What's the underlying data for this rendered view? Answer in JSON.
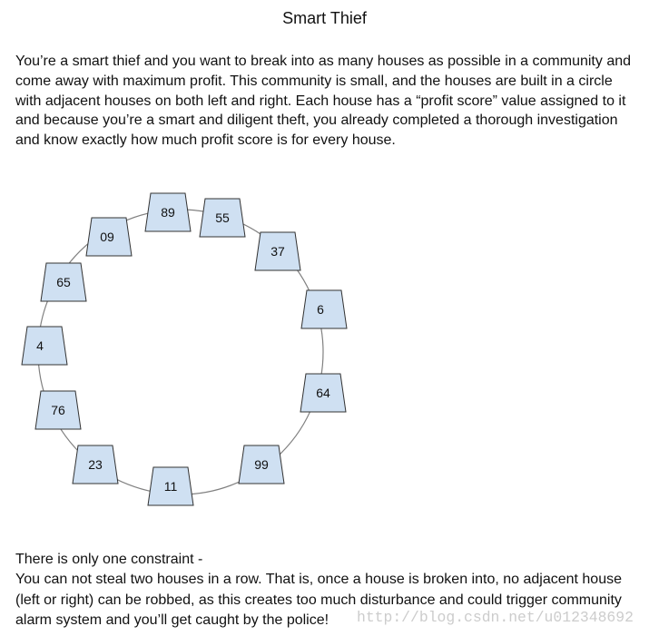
{
  "title": "Smart Thief",
  "intro_lines": [
    "You’re a smart thief and you want to break into as many houses as possible in a community and",
    "come away with maximum profit. This community is small, and the houses are built in a circle",
    "with adjacent houses on both left and right. Each house has a “profit score” value assigned to it",
    "and because you’re a smart and diligent theft, you already completed a thorough investigation",
    "and know exactly how much profit score is for every house."
  ],
  "diagram": {
    "houses": [
      "89",
      "55",
      "37",
      "6",
      "64",
      "99",
      "11",
      "23",
      "76",
      "4",
      "65",
      "09"
    ],
    "colors": {
      "house_fill": "#cfe0f2",
      "house_stroke": "#333333",
      "ring_stroke": "#808080",
      "label_color": "#111111"
    }
  },
  "constraint_lines": [
    "There is only one constraint -",
    "You can not steal two houses in a row. That is, once a house is broken into, no adjacent house",
    "(left or right) can be robbed, as this creates too much disturbance and could trigger community",
    "alarm system and you’ll get caught by the police!"
  ],
  "watermark": "http://blog.csdn.net/u012348692",
  "watermark_color": "#cccccc"
}
